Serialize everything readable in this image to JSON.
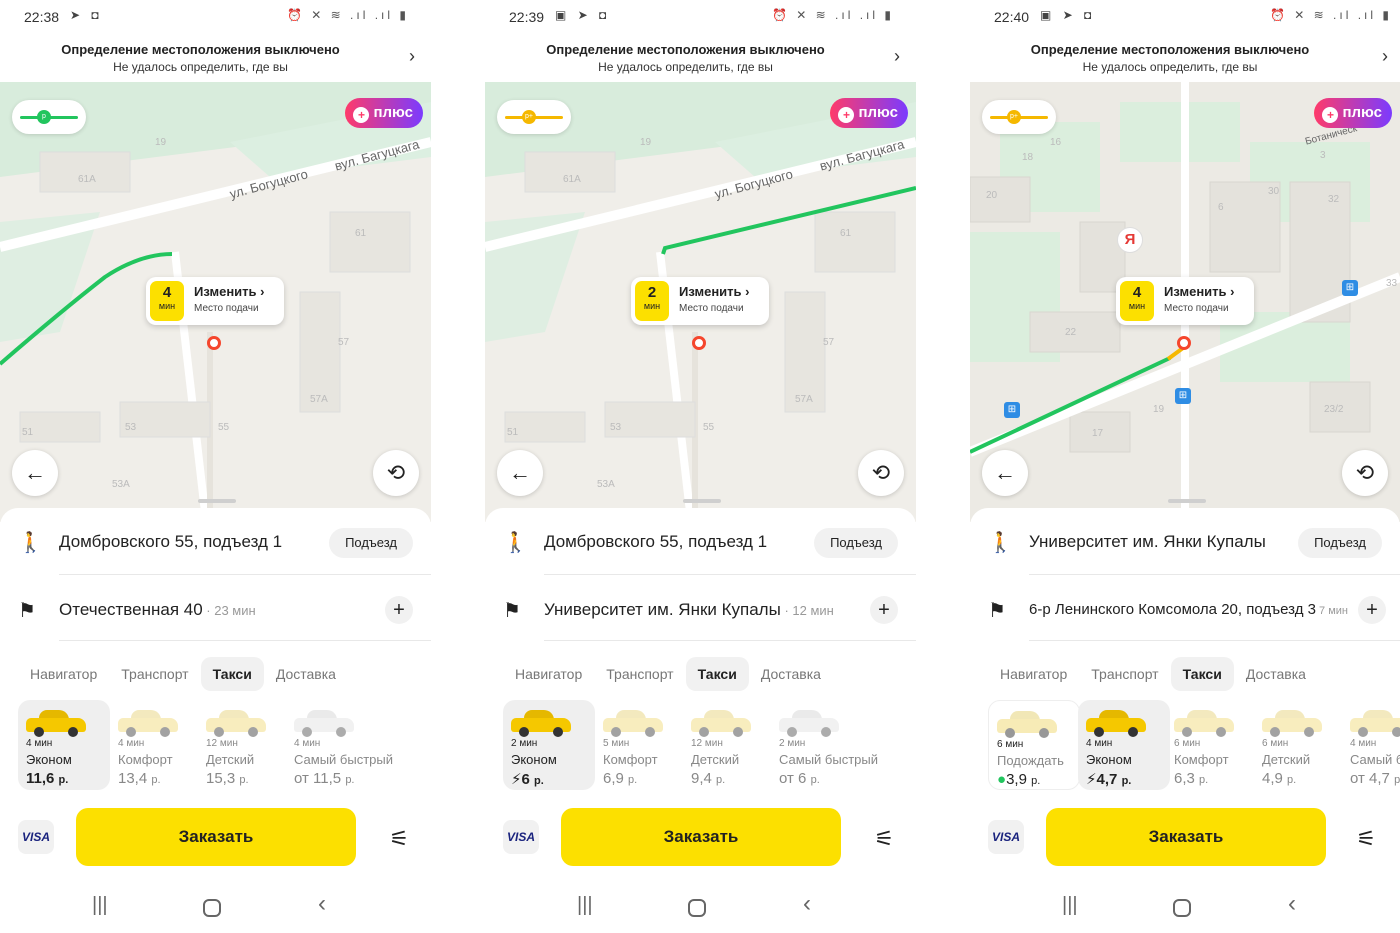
{
  "screens": [
    {
      "status": {
        "time": "22:38",
        "left_icons": "➤ ◘",
        "right_icons": "⏰ ✕ ≋ .ıl .ıl ▮"
      },
      "banner": {
        "title": "Определение местоположения выключено",
        "subtitle": "Не удалось определить, где вы"
      },
      "map": {
        "traffic_color": "#22c55e",
        "traffic_label": "р",
        "plus_label": "плюс",
        "streets": [
          "ул. Богуцкого",
          "вул. Багуцкага"
        ],
        "house_numbers": [
          "19",
          "61А",
          "61",
          "57",
          "57А",
          "53",
          "55",
          "51",
          "53А"
        ],
        "eta_minutes": "4",
        "eta_unit": "мин",
        "change_label": "Изменить ›",
        "pickup_label": "Место подачи"
      },
      "route": {
        "from": "Домбровского 55, подъезд 1",
        "entrance_label": "Подъезд",
        "to": "Отечественная 40",
        "to_time": " · 23 мин"
      },
      "tabs": [
        {
          "label": "Навигатор",
          "active": false
        },
        {
          "label": "Транспорт",
          "active": false
        },
        {
          "label": "Такси",
          "active": true
        },
        {
          "label": "Доставка",
          "active": false
        }
      ],
      "tariffs": [
        {
          "eta": "4 мин",
          "name": "Эконом",
          "price": "11,6",
          "unit": "р.",
          "active": true
        },
        {
          "eta": "4 мин",
          "name": "Комфорт",
          "price": "13,4",
          "unit": "р.",
          "active": false
        },
        {
          "eta": "12 мин",
          "name": "Детский",
          "price": "15,3",
          "unit": "р.",
          "active": false
        },
        {
          "eta": "4 мин",
          "name": "Самый быстрый",
          "price": "от 11,5",
          "unit": "р.",
          "active": false
        }
      ],
      "payment": "VISA",
      "order_label": "Заказать"
    },
    {
      "status": {
        "time": "22:39",
        "left_icons": "▣ ➤ ◘",
        "right_icons": "⏰ ✕ ≋ .ıl .ıl ▮"
      },
      "banner": {
        "title": "Определение местоположения выключено",
        "subtitle": "Не удалось определить, где вы"
      },
      "map": {
        "traffic_color": "#f5b800",
        "traffic_label": "р+",
        "plus_label": "плюс",
        "streets": [
          "ул. Богуцкого",
          "вул. Багуцкага"
        ],
        "house_numbers": [
          "19",
          "61А",
          "61",
          "57",
          "57А",
          "53",
          "55",
          "51",
          "53А"
        ],
        "eta_minutes": "2",
        "eta_unit": "мин",
        "change_label": "Изменить ›",
        "pickup_label": "Место подачи"
      },
      "route": {
        "from": "Домбровского 55, подъезд 1",
        "entrance_label": "Подъезд",
        "to": "Университет им. Янки Купалы",
        "to_time": " · 12 мин"
      },
      "tabs": [
        {
          "label": "Навигатор",
          "active": false
        },
        {
          "label": "Транспорт",
          "active": false
        },
        {
          "label": "Такси",
          "active": true
        },
        {
          "label": "Доставка",
          "active": false
        }
      ],
      "tariffs": [
        {
          "eta": "2 мин",
          "name": "Эконом",
          "price": "⚡6",
          "unit": "р.",
          "active": true
        },
        {
          "eta": "5 мин",
          "name": "Комфорт",
          "price": "6,9",
          "unit": "р.",
          "active": false
        },
        {
          "eta": "12 мин",
          "name": "Детский",
          "price": "9,4",
          "unit": "р.",
          "active": false
        },
        {
          "eta": "2 мин",
          "name": "Самый быстрый",
          "price": "от 6",
          "unit": "р.",
          "active": false
        }
      ],
      "payment": "VISA",
      "order_label": "Заказать"
    },
    {
      "status": {
        "time": "22:40",
        "left_icons": "▣ ➤ ◘",
        "right_icons": "⏰ ✕ ≋ .ıl .ıl ▮"
      },
      "banner": {
        "title": "Определение местоположения выключено",
        "subtitle": "Не удалось определить, где вы"
      },
      "map": {
        "traffic_color": "#f5b800",
        "traffic_label": "р+",
        "plus_label": "плюс",
        "streets": [
          "Ботаническ"
        ],
        "house_numbers": [
          "18",
          "16",
          "20",
          "3",
          "30",
          "32",
          "6",
          "33",
          "22",
          "19",
          "17",
          "23/2"
        ],
        "eta_minutes": "4",
        "eta_unit": "мин",
        "change_label": "Изменить ›",
        "pickup_label": "Место подачи"
      },
      "route": {
        "from": "Университет им. Янки Купалы",
        "entrance_label": "Подъезд",
        "to": "6-р Ленинского Комсомола 20, подъезд 3",
        "to_time": " 7 мин"
      },
      "tabs": [
        {
          "label": "Навигатор",
          "active": false
        },
        {
          "label": "Транспорт",
          "active": false
        },
        {
          "label": "Такси",
          "active": true
        },
        {
          "label": "Доставка",
          "active": false
        }
      ],
      "tariffs": [
        {
          "eta": "6 мин",
          "name": "Подождать",
          "price": "3,9",
          "unit": "р.",
          "active": false
        },
        {
          "eta": "4 мин",
          "name": "Эконом",
          "price": "⚡4,7",
          "unit": "р.",
          "active": true
        },
        {
          "eta": "6 мин",
          "name": "Комфорт",
          "price": "6,3",
          "unit": "р.",
          "active": false
        },
        {
          "eta": "6 мин",
          "name": "Детский",
          "price": "4,9",
          "unit": "р.",
          "active": false
        },
        {
          "eta": "4 мин",
          "name": "Самый б",
          "price": "от 4,7",
          "unit": "р.",
          "active": false
        }
      ],
      "payment": "VISA",
      "order_label": "Заказать"
    }
  ]
}
